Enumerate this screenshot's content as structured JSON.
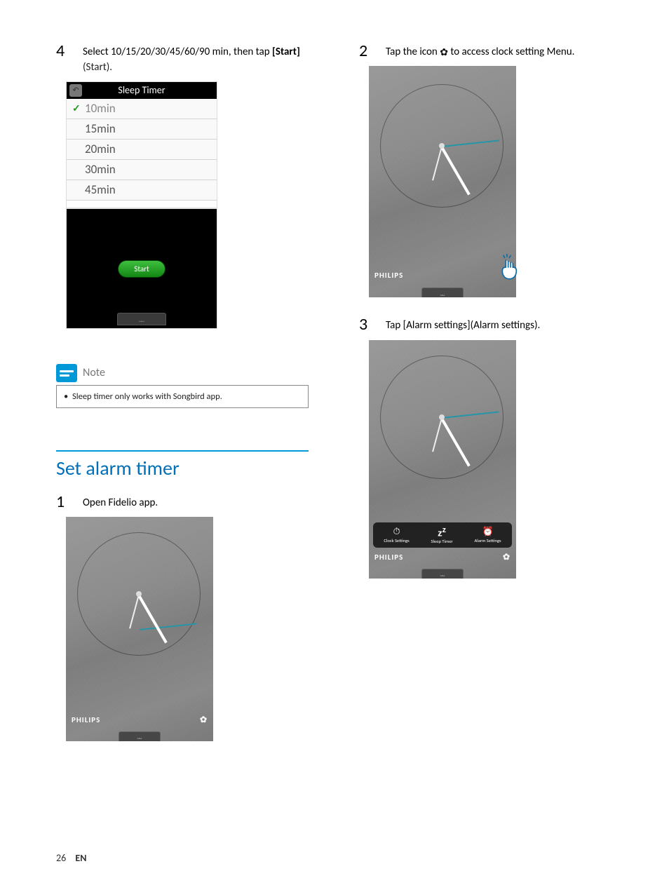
{
  "left": {
    "step4": {
      "num": "4",
      "line1": "Select 10/15/20/30/45/60/90 min, then tap ",
      "bold": "[Start]",
      "paren": " (Start)."
    },
    "sleep": {
      "title": "Sleep Timer",
      "rows": [
        "10min",
        "15min",
        "20min",
        "30min",
        "45min"
      ],
      "start": "Start"
    },
    "note": {
      "label": "Note",
      "body": "Sleep timer only works with Songbird app."
    },
    "section_title": "Set alarm timer",
    "step1": {
      "num": "1",
      "text": "Open Fidelio app."
    },
    "brand": "PHILIPS"
  },
  "right": {
    "step2": {
      "num": "2",
      "pre": "Tap the icon ",
      "post": " to access clock setting Menu."
    },
    "brand": "PHILIPS",
    "step3": {
      "num": "3",
      "text": "Tap [Alarm settings](Alarm settings)."
    },
    "menu": {
      "clock": "Clock Settings",
      "sleep": "Sleep Timer",
      "alarm": "Alarm Settings"
    }
  },
  "footer": {
    "page": "26",
    "lang": "EN"
  }
}
